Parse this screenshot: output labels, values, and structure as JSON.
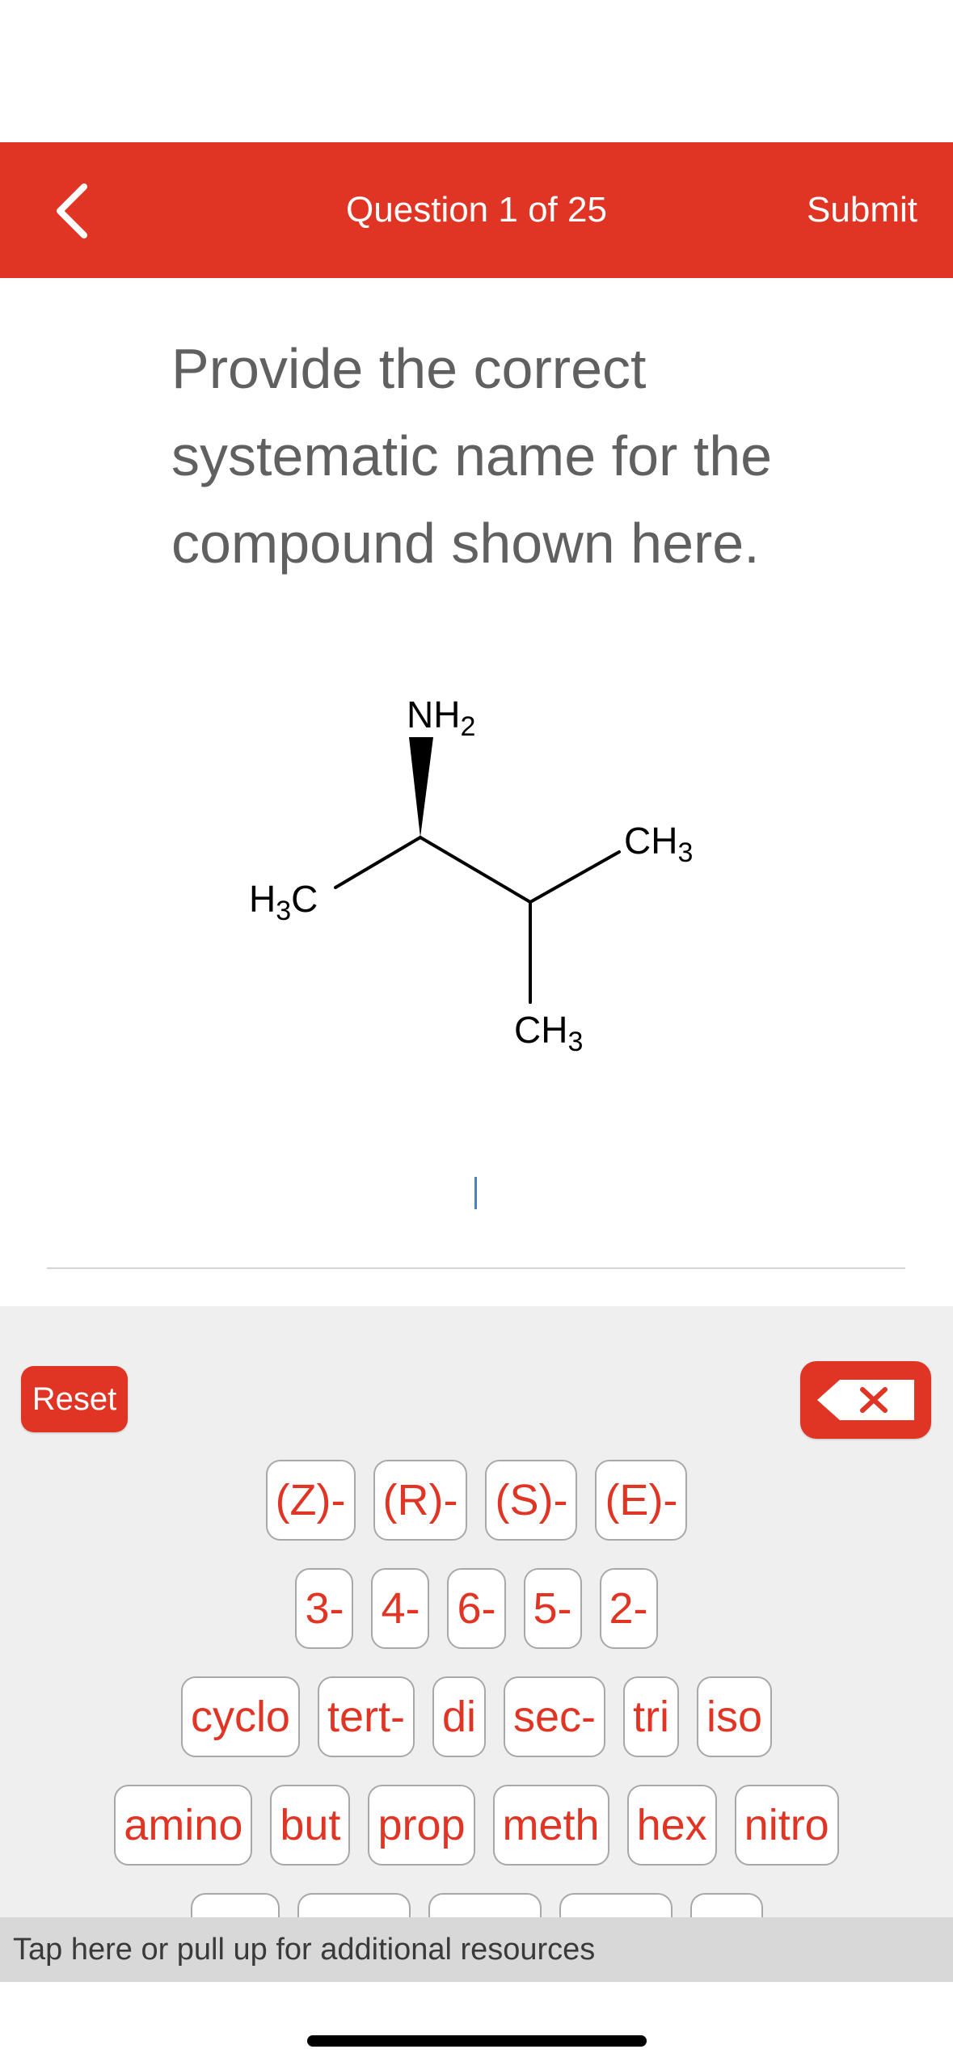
{
  "header": {
    "title": "Question 1 of 25",
    "submit_label": "Submit",
    "back_icon": "chevron-left-icon",
    "color": "#e03524"
  },
  "question": {
    "text": "Provide the correct systematic name for the compound shown here."
  },
  "molecule": {
    "labels": {
      "nh2_main": "NH",
      "nh2_sub": "2",
      "ch3_right_main": "CH",
      "ch3_right_sub": "3",
      "h3c_h": "H",
      "h3c_sub": "3",
      "h3c_c": "C",
      "ch3_bottom_main": "CH",
      "ch3_bottom_sub": "3"
    }
  },
  "keyboard": {
    "reset_label": "Reset",
    "backspace_icon": "backspace-icon",
    "rows": [
      [
        "(Z)-",
        "(R)-",
        "(S)-",
        "(E)-"
      ],
      [
        "3-",
        "4-",
        "6-",
        "5-",
        "2-"
      ],
      [
        "cyclo",
        "tert-",
        "di",
        "sec-",
        "tri",
        "iso"
      ],
      [
        "amino",
        "but",
        "prop",
        "meth",
        "hex",
        "nitro"
      ]
    ]
  },
  "resources": {
    "label": "Tap here or pull up for additional resources"
  }
}
